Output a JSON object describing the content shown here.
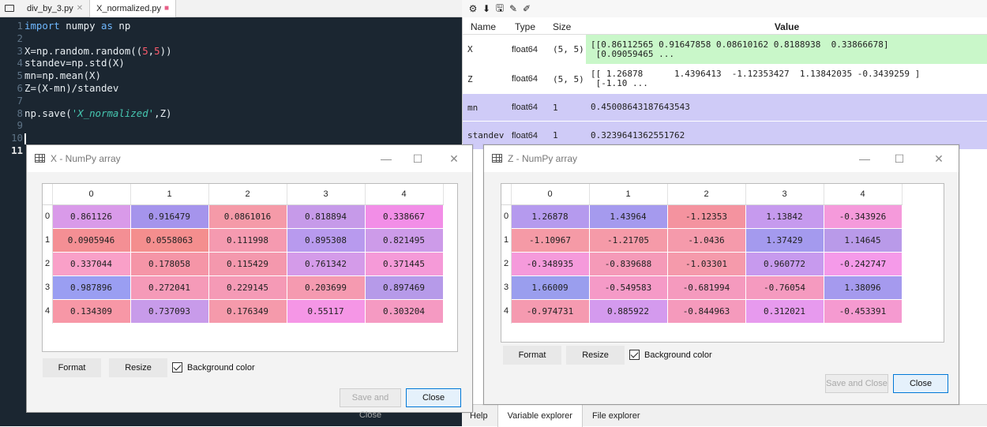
{
  "editor": {
    "tabs": [
      {
        "label": "div_by_3.py",
        "close": "✕"
      },
      {
        "label": "X_normalized.py",
        "close": "■"
      }
    ],
    "line_numbers": [
      "1",
      "2",
      "3",
      "4",
      "5",
      "6",
      "7",
      "8",
      "9",
      "10",
      "11"
    ],
    "lines": [
      {
        "segments": [
          {
            "t": "import",
            "c": "kw"
          },
          {
            "t": " numpy ",
            "c": "nm"
          },
          {
            "t": "as",
            "c": "kw"
          },
          {
            "t": " np",
            "c": "nm"
          }
        ]
      },
      {
        "segments": []
      },
      {
        "segments": [
          {
            "t": "X=np.random.random((",
            "c": "nm"
          },
          {
            "t": "5",
            "c": "ar"
          },
          {
            "t": ",",
            "c": "nm"
          },
          {
            "t": "5",
            "c": "ar"
          },
          {
            "t": "))",
            "c": "nm"
          }
        ]
      },
      {
        "segments": [
          {
            "t": "standev=np.std(X)",
            "c": "nm"
          }
        ]
      },
      {
        "segments": [
          {
            "t": "mn=np.mean(X)",
            "c": "nm"
          }
        ]
      },
      {
        "segments": [
          {
            "t": "Z=(X-mn)/standev",
            "c": "nm"
          }
        ]
      },
      {
        "segments": []
      },
      {
        "segments": [
          {
            "t": "np.save(",
            "c": "nm"
          },
          {
            "t": "'X_normalized'",
            "c": "st"
          },
          {
            "t": ",Z)",
            "c": "nm"
          }
        ]
      },
      {
        "segments": []
      },
      {
        "segments": []
      },
      {
        "segments": []
      }
    ]
  },
  "variable_explorer": {
    "headers": {
      "name": "Name",
      "type": "Type",
      "size": "Size",
      "value": "Value"
    },
    "rows": [
      {
        "name": "X",
        "type": "float64",
        "size": "(5, 5)",
        "value": "[[0.86112565 0.91647858 0.08610162 0.8188938  0.33866678]\n [0.09059465 ...",
        "color": "#c9f7c9"
      },
      {
        "name": "Z",
        "type": "float64",
        "size": "(5, 5)",
        "value": "[[ 1.26878      1.4396413  -1.12353427  1.13842035 -0.3439259 ]\n [-1.10 ...",
        "color": "#ffffff"
      },
      {
        "name": "mn",
        "type": "float64",
        "size": "1",
        "value": "0.45008643187643543",
        "color": "#cfcbf7"
      },
      {
        "name": "standev",
        "type": "float64",
        "size": "1",
        "value": "0.3239641362551762",
        "color": "#cfcbf7"
      }
    ]
  },
  "bottom_tabs": [
    "Help",
    "Variable explorer",
    "File explorer"
  ],
  "dialog_x": {
    "title": "X - NumPy array",
    "columns": [
      "0",
      "1",
      "2",
      "3",
      "4"
    ],
    "row_labels": [
      "0",
      "1",
      "2",
      "3",
      "4"
    ],
    "values": [
      [
        "0.861126",
        "0.916479",
        "0.0861016",
        "0.818894",
        "0.338667"
      ],
      [
        "0.0905946",
        "0.0558063",
        "0.111998",
        "0.895308",
        "0.821495"
      ],
      [
        "0.337044",
        "0.178058",
        "0.115429",
        "0.761342",
        "0.371445"
      ],
      [
        "0.987896",
        "0.272041",
        "0.229145",
        "0.203699",
        "0.897469"
      ],
      [
        "0.134309",
        "0.737093",
        "0.176349",
        "0.55117",
        "0.303204"
      ]
    ],
    "colors": [
      [
        "#d99ae9",
        "#a594ec",
        "#f59aa8",
        "#c69ae9",
        "#f28ee7"
      ],
      [
        "#f48f94",
        "#f48e8e",
        "#f59ab0",
        "#b89aee",
        "#cd9be9"
      ],
      [
        "#f9a0c8",
        "#f595a7",
        "#f498ad",
        "#d49be9",
        "#f59ad8"
      ],
      [
        "#9a9ef2",
        "#f59ab8",
        "#f59ab6",
        "#f59ab0",
        "#b69ae9"
      ],
      [
        "#f797a6",
        "#c89bea",
        "#f59aab",
        "#f596e6",
        "#f59ac2"
      ]
    ],
    "format_label": "Format",
    "resize_label": "Resize",
    "bgcolor_label": "Background color",
    "save_close_label": "Save and Close",
    "close_label": "Close"
  },
  "dialog_z": {
    "title": "Z - NumPy array",
    "columns": [
      "0",
      "1",
      "2",
      "3",
      "4"
    ],
    "row_labels": [
      "0",
      "1",
      "2",
      "3",
      "4"
    ],
    "values": [
      [
        "1.26878",
        "1.43964",
        "-1.12353",
        "1.13842",
        "-0.343926"
      ],
      [
        "-1.10967",
        "-1.21705",
        "-1.0436",
        "1.37429",
        "1.14645"
      ],
      [
        "-0.348935",
        "-0.839688",
        "-1.03301",
        "0.960772",
        "-0.242747"
      ],
      [
        "1.66009",
        "-0.549583",
        "-0.681994",
        "-0.76054",
        "1.38096"
      ],
      [
        "-0.974731",
        "0.885922",
        "-0.844963",
        "0.312021",
        "-0.453391"
      ]
    ],
    "colors": [
      [
        "#b59aee",
        "#a59aee",
        "#f4939f",
        "#c69aee",
        "#f59adb"
      ],
      [
        "#f59aa6",
        "#f59aa8",
        "#f59aab",
        "#a49aee",
        "#b99ae9"
      ],
      [
        "#f59adb",
        "#f59ab8",
        "#f59aab",
        "#c79aee",
        "#f59ae9"
      ],
      [
        "#9a9eee",
        "#f59ac7",
        "#f59abe",
        "#f59abf",
        "#a59aee"
      ],
      [
        "#f59ab0",
        "#d49aee",
        "#f59abc",
        "#e79aee",
        "#f59ad0"
      ]
    ],
    "format_label": "Format",
    "resize_label": "Resize",
    "bgcolor_label": "Background color",
    "save_close_label": "Save and Close",
    "close_label": "Close"
  },
  "window_buttons": {
    "minimize": "—",
    "maximize": "☐",
    "close": "✕"
  }
}
